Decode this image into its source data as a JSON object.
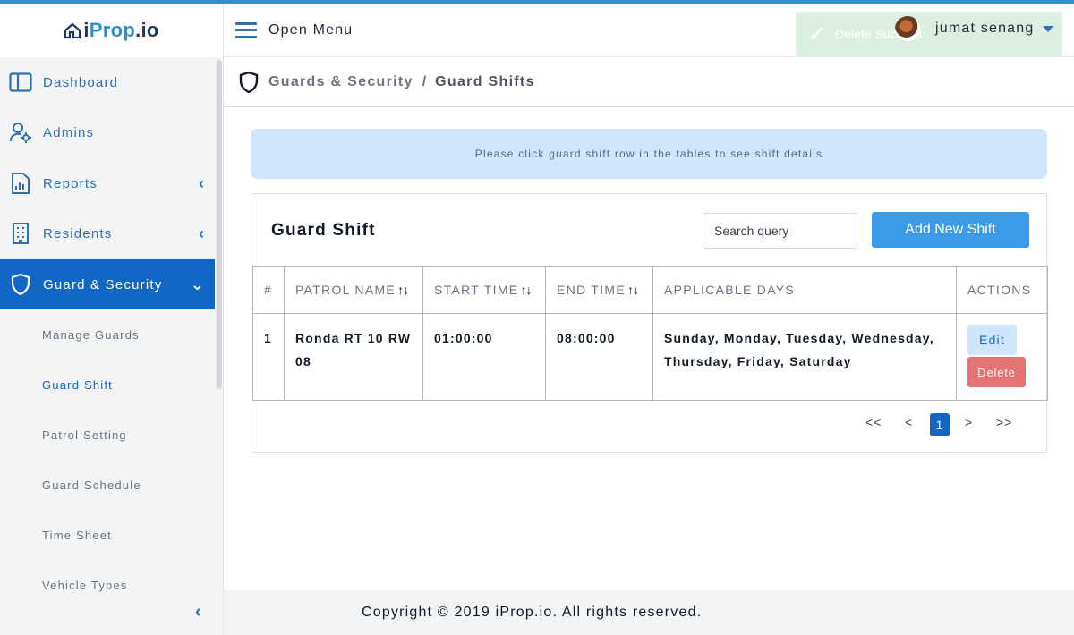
{
  "app": {
    "logo_prefix": "i",
    "logo_prop": "Prop",
    "logo_dot": ".",
    "logo_io": "io"
  },
  "topbar": {
    "menu_label": "Open Menu",
    "username": "jumat senang",
    "toast_text": "Delete Success"
  },
  "sidebar": {
    "items": [
      {
        "label": "Dashboard",
        "icon": "dashboard-icon"
      },
      {
        "label": "Admins",
        "icon": "admin-user-gear-icon"
      },
      {
        "label": "Reports",
        "icon": "report-document-icon"
      },
      {
        "label": "Residents",
        "icon": "building-icon"
      },
      {
        "label": "Guard & Security",
        "icon": "shield-icon"
      }
    ],
    "submenu": [
      "Manage Guards",
      "Guard Shift",
      "Patrol Setting",
      "Guard Schedule",
      "Time Sheet",
      "Vehicle Types"
    ],
    "active_submenu": "Guard Shift"
  },
  "breadcrumb": {
    "parent": "Guards & Security",
    "separator": "/",
    "current": "Guard Shifts"
  },
  "info_text": "Please click guard shift row in the tables to see shift details",
  "card": {
    "title": "Guard Shift",
    "search_placeholder": "Search query",
    "add_button": "Add New Shift"
  },
  "table": {
    "headers": [
      "#",
      "PATROL NAME",
      "START TIME",
      "END TIME",
      "APPLICABLE DAYS",
      "ACTIONS"
    ],
    "sort_glyph": "↑↓",
    "rows": [
      {
        "no": "1",
        "patrol_name": "Ronda RT 10 RW 08",
        "start_time": "01:00:00",
        "end_time": "08:00:00",
        "days": "Sunday, Monday, Tuesday, Wednesday, Thursday, Friday, Saturday",
        "edit": "Edit",
        "delete": "Delete"
      }
    ]
  },
  "pagination": {
    "first": "<<",
    "prev": "<",
    "current": "1",
    "next": ">",
    "last": ">>"
  },
  "footer": "Copyright © 2019 iProp.io. All rights reserved.",
  "colors": {
    "primary": "#1266c4",
    "accent": "#3a9be8",
    "danger": "#e57373",
    "info_bg": "#cfe5fb",
    "toast_bg": "#d4edda"
  }
}
